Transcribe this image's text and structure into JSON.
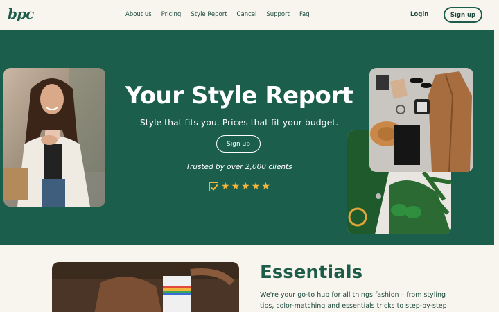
{
  "brand": {
    "logo": "bpc"
  },
  "nav": {
    "links": [
      "About us",
      "Pricing",
      "Style Report",
      "Cancel",
      "Support",
      "Faq"
    ],
    "login": "Login",
    "signup": "Sign up"
  },
  "hero": {
    "title": "Your Style Report",
    "subtitle": "Style that fits you. Prices that fit your budget.",
    "cta": "Sign up",
    "trusted": "Trusted by over 2,000 clients",
    "rating_stars": 5,
    "star_color": "#f2b53d",
    "background": "#1b5e4c"
  },
  "essentials": {
    "title": "Essentials",
    "text": "We're your go-to hub for all things fashion – from styling tips, color-matching and essentials tricks to step-by-step"
  }
}
